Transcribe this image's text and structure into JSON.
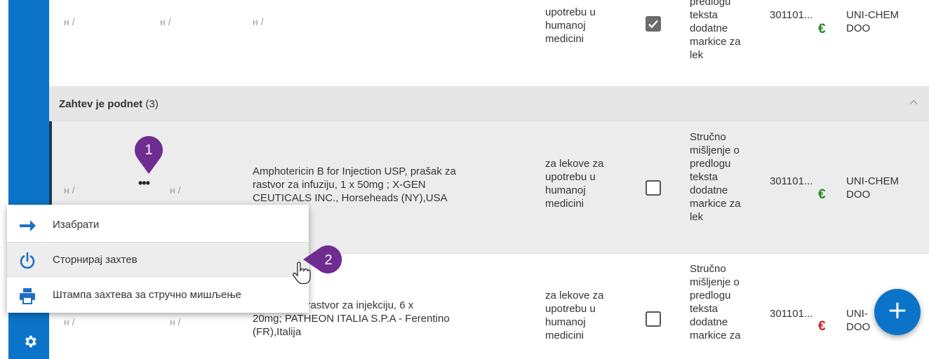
{
  "row_top": {
    "col1": "н /",
    "col2": "н /",
    "col3": "н /",
    "type_lines": [
      "upotrebu u",
      "humanoj",
      "medicini"
    ],
    "opinion_lines": [
      "predlogu",
      "teksta",
      "dodatne",
      "markice za",
      "lek"
    ],
    "code": "301101...",
    "company_lines": [
      "UNI-CHEM",
      "DOO"
    ]
  },
  "group": {
    "title": "Zahtev je podnet",
    "count": "(3)"
  },
  "row_selected": {
    "col1": "н /",
    "col2": "н /",
    "product_lines": [
      "Amphotericin B for Injection USP, prašak za",
      "rastvor za infuziju, 1 x 50mg ; X-GEN",
      "CEUTICALS INC., Horseheads (NY),USA"
    ],
    "type_lines": [
      "za lekove za",
      "upotrebu u",
      "humanoj",
      "medicini"
    ],
    "opinion_lines": [
      "Stručno",
      "mišljenje o",
      "predlogu",
      "teksta",
      "dodatne",
      "markice za",
      "lek"
    ],
    "code": "301101...",
    "company_lines": [
      "UNI-CHEM",
      "DOO"
    ]
  },
  "row_bottom": {
    "col1": "н /",
    "col2": "н /",
    "product_lines": [
      ", prašak za rastvor za injekciju, 6 x",
      "20mg; PATHEON ITALIA S.P.A - Ferentino",
      "(FR),Italija"
    ],
    "type_lines": [
      "za lekove za",
      "upotrebu u",
      "humanoj",
      "medicini"
    ],
    "opinion_lines": [
      "Stručno",
      "mišljenje o",
      "predlogu",
      "teksta",
      "dodatne",
      "markice za"
    ],
    "code": "301101...",
    "company_lines": [
      "UNI-",
      "DOO"
    ]
  },
  "euro_symbol": "€",
  "dots": "•••",
  "menu": {
    "items": [
      {
        "label": "Изабрати",
        "icon": "arrow-right-icon"
      },
      {
        "label": "Сторнирај захтев",
        "icon": "power-icon"
      },
      {
        "label": "Штампа захтева за стручно мишљење",
        "icon": "printer-icon"
      }
    ]
  },
  "callouts": {
    "one": "1",
    "two": "2"
  },
  "fab_label": "+",
  "colors": {
    "accent": "#0b74c9",
    "callout": "#6f2c91",
    "euro_green": "#1e8a1e",
    "euro_red": "#d0201b"
  }
}
